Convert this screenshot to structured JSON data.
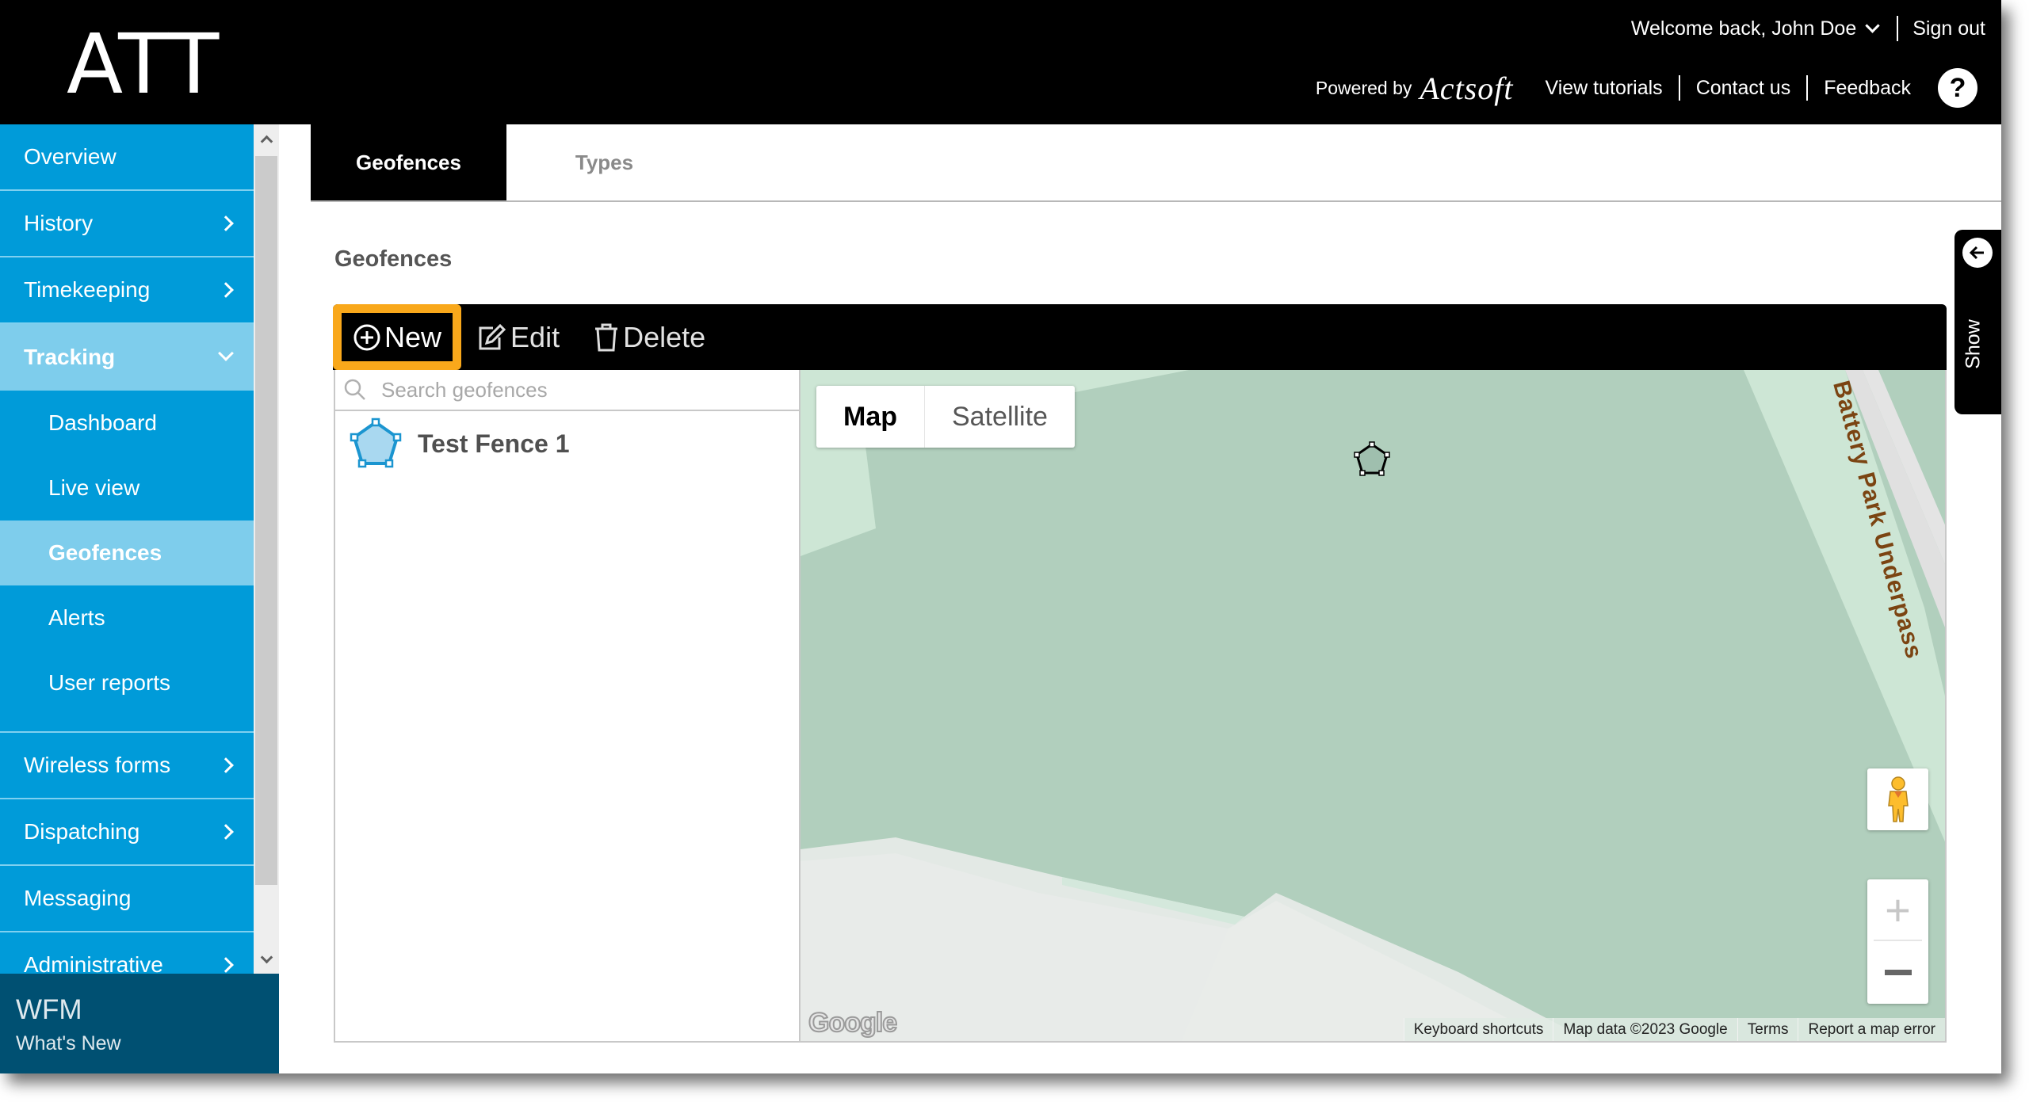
{
  "header": {
    "brand": "ATT",
    "welcome": "Welcome back, John Doe",
    "sign_out": "Sign out",
    "powered_by": "Powered by",
    "powered_brand": "Actsoft",
    "links": [
      "View tutorials",
      "Contact us",
      "Feedback"
    ],
    "help_symbol": "?"
  },
  "sidebar": {
    "items": [
      {
        "label": "Overview",
        "icon": "none"
      },
      {
        "label": "History",
        "icon": "chevron-right-icon"
      },
      {
        "label": "Timekeeping",
        "icon": "chevron-right-icon"
      },
      {
        "label": "Tracking",
        "icon": "chevron-down-icon",
        "expanded": true
      },
      {
        "label": "Wireless forms",
        "icon": "chevron-right-icon"
      },
      {
        "label": "Dispatching",
        "icon": "chevron-right-icon"
      },
      {
        "label": "Messaging",
        "icon": "none"
      },
      {
        "label": "Administrative",
        "icon": "chevron-right-icon"
      }
    ],
    "tracking_subitems": [
      {
        "label": "Dashboard"
      },
      {
        "label": "Live view"
      },
      {
        "label": "Geofences",
        "active": true
      },
      {
        "label": "Alerts"
      },
      {
        "label": "User reports"
      }
    ],
    "footer": {
      "title": "WFM",
      "subtitle": "What's New"
    }
  },
  "tabs": [
    {
      "label": "Geofences",
      "active": true
    },
    {
      "label": "Types",
      "active": false
    }
  ],
  "page_title": "Geofences",
  "toolbar": {
    "new_label": "New",
    "edit_label": "Edit",
    "delete_label": "Delete",
    "highlight_color": "#f9a81b"
  },
  "list": {
    "search_placeholder": "Search geofences",
    "search_value": "",
    "items": [
      {
        "name": "Test Fence 1",
        "icon": "pentagon-geofence-icon"
      }
    ]
  },
  "map": {
    "type_options": [
      "Map",
      "Satellite"
    ],
    "selected_type": "Map",
    "road_label": "Battery Park Underpass",
    "zoom_in": "+",
    "zoom_out": "−",
    "logo": "Google",
    "attribution": [
      "Keyboard shortcuts",
      "Map data ©2023 Google",
      "Terms",
      "Report a map error"
    ]
  },
  "show_panel": {
    "label": "Show"
  },
  "colors": {
    "header_bg": "#000000",
    "sidebar_bg": "#009bd9",
    "sidebar_active": "#7ecdec",
    "footer_bg": "#005072",
    "map_park": "#b1cfbd"
  }
}
